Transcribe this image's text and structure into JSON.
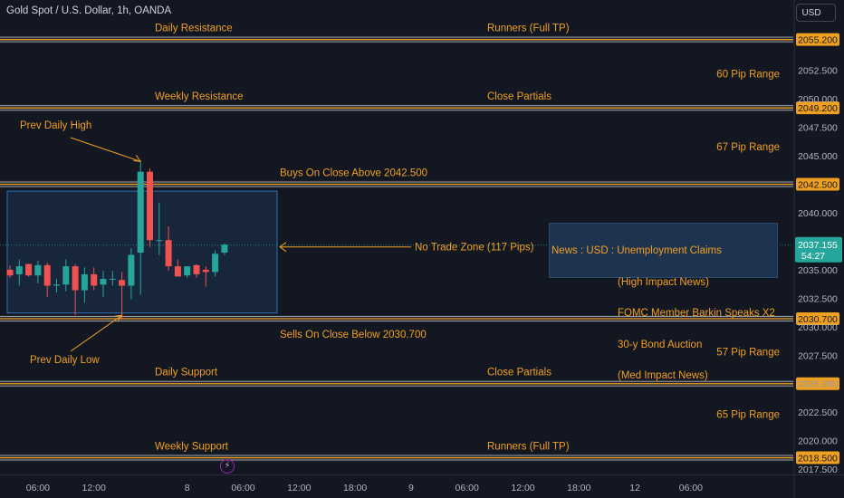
{
  "header": {
    "symbol_title": "Gold Spot / U.S. Dollar, 1h, OANDA",
    "currency": "USD"
  },
  "news": {
    "lines": [
      "News : USD : Unemployment Claims",
      "(High Impact News)",
      "FOMC Member Barkin Speaks X2",
      "30-y Bond Auction",
      "(Med Impact News)"
    ]
  },
  "colors": {
    "background": "#131722",
    "level_line": "#f0a020",
    "annotation_text": "#f0a020",
    "bull": "#26a69a",
    "bear": "#ef5350",
    "axis_text": "#b2b5be",
    "zone_fill": "#1e3350"
  },
  "icons": {
    "event_flag": "lightning-icon"
  },
  "chart_data": {
    "type": "candlestick",
    "symbol": "Gold Spot / U.S. Dollar",
    "interval": "1h",
    "ylim": [
      2016.5,
      2058
    ],
    "y_ticks": [
      2017.5,
      2020,
      2022.5,
      2025,
      2027.5,
      2030,
      2032.5,
      2035,
      2040,
      2045,
      2047.5,
      2050,
      2052.5
    ],
    "x_ticks": [
      {
        "label": "06:00",
        "bar": 3
      },
      {
        "label": "12:00",
        "bar": 9
      },
      {
        "label": "8",
        "bar": 19
      },
      {
        "label": "06:00",
        "bar": 25
      },
      {
        "label": "12:00",
        "bar": 31
      },
      {
        "label": "18:00",
        "bar": 37
      },
      {
        "label": "9",
        "bar": 43
      },
      {
        "label": "06:00",
        "bar": 49
      },
      {
        "label": "12:00",
        "bar": 55
      },
      {
        "label": "18:00",
        "bar": 61
      },
      {
        "label": "12",
        "bar": 67
      },
      {
        "label": "06:00",
        "bar": 73
      }
    ],
    "candles": [
      {
        "o": 2035.0,
        "h": 2035.4,
        "l": 2034.3,
        "c": 2034.5
      },
      {
        "o": 2034.6,
        "h": 2035.9,
        "l": 2033.6,
        "c": 2035.3
      },
      {
        "o": 2035.5,
        "h": 2035.5,
        "l": 2034.4,
        "c": 2034.5
      },
      {
        "o": 2034.5,
        "h": 2035.8,
        "l": 2033.8,
        "c": 2035.4
      },
      {
        "o": 2035.4,
        "h": 2035.6,
        "l": 2032.6,
        "c": 2033.6
      },
      {
        "o": 2033.6,
        "h": 2034.2,
        "l": 2033.0,
        "c": 2033.7
      },
      {
        "o": 2033.7,
        "h": 2035.9,
        "l": 2033.1,
        "c": 2035.3
      },
      {
        "o": 2035.3,
        "h": 2035.5,
        "l": 2031.0,
        "c": 2033.2
      },
      {
        "o": 2033.2,
        "h": 2035.2,
        "l": 2032.1,
        "c": 2034.6
      },
      {
        "o": 2034.6,
        "h": 2035.2,
        "l": 2033.2,
        "c": 2033.6
      },
      {
        "o": 2033.7,
        "h": 2034.9,
        "l": 2032.6,
        "c": 2034.2
      },
      {
        "o": 2034.2,
        "h": 2034.9,
        "l": 2033.6,
        "c": 2034.2
      },
      {
        "o": 2034.1,
        "h": 2034.8,
        "l": 2030.7,
        "c": 2033.6
      },
      {
        "o": 2033.6,
        "h": 2036.9,
        "l": 2032.4,
        "c": 2036.3
      },
      {
        "o": 2036.5,
        "h": 2044.5,
        "l": 2032.8,
        "c": 2043.6
      },
      {
        "o": 2043.6,
        "h": 2043.9,
        "l": 2037.0,
        "c": 2037.6
      },
      {
        "o": 2037.6,
        "h": 2040.9,
        "l": 2036.3,
        "c": 2037.6
      },
      {
        "o": 2037.6,
        "h": 2038.8,
        "l": 2034.9,
        "c": 2035.3
      },
      {
        "o": 2035.3,
        "h": 2035.9,
        "l": 2034.4,
        "c": 2034.4
      },
      {
        "o": 2034.5,
        "h": 2035.3,
        "l": 2034.3,
        "c": 2035.3
      },
      {
        "o": 2035.4,
        "h": 2035.5,
        "l": 2034.3,
        "c": 2034.6
      },
      {
        "o": 2035.0,
        "h": 2035.3,
        "l": 2033.5,
        "c": 2034.8
      },
      {
        "o": 2034.8,
        "h": 2036.7,
        "l": 2034.4,
        "c": 2036.4
      },
      {
        "o": 2036.5,
        "h": 2037.3,
        "l": 2036.3,
        "c": 2037.2
      }
    ],
    "levels": [
      {
        "price": 2055.2,
        "label": "2055.200",
        "left_text": "Daily Resistance",
        "center_text": "Runners (Full TP)"
      },
      {
        "price": 2049.2,
        "label": "2049.200",
        "left_text": "Weekly Resistance",
        "center_text": "Close Partials"
      },
      {
        "price": 2042.5,
        "label": "2042.500",
        "left_text": "",
        "center_text": "Buys On Close Above 2042.500"
      },
      {
        "price": 2030.7,
        "label": "2030.700",
        "left_text": "",
        "center_text": "Sells On Close Below 2030.700"
      },
      {
        "price": 2025.0,
        "label": "2025.000",
        "left_text": "Daily Support",
        "center_text": "Close Partials"
      },
      {
        "price": 2018.5,
        "label": "2018.500",
        "left_text": "Weekly Support",
        "center_text": "Runners (Full TP)"
      }
    ],
    "ranges": [
      {
        "text": "60 Pip Range",
        "price": 2052.2
      },
      {
        "text": "67 Pip Range",
        "price": 2045.8
      },
      {
        "text": "57 Pip Range",
        "price": 2027.8
      },
      {
        "text": "65 Pip Range",
        "price": 2022.3
      }
    ],
    "no_trade_zone": {
      "text": "No Trade Zone (117 Pips)",
      "top": 2041.9,
      "bottom": 2031.2,
      "from_bar": 0,
      "to_bar": 30
    },
    "prev_daily_high": {
      "text": "Prev Daily High",
      "price": 2044.5,
      "bar": 14
    },
    "prev_daily_low": {
      "text": "Prev Daily Low",
      "price": 2031.0,
      "bar": 12
    },
    "current_price": {
      "price": 2037.155,
      "label": "2037.155",
      "countdown": "54:27"
    }
  }
}
